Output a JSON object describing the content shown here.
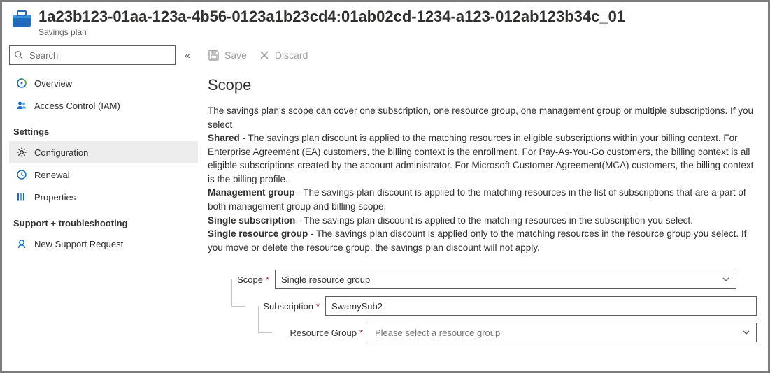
{
  "header": {
    "title": "1a23b123-01aa-123a-4b56-0123a1b23cd4:01ab02cd-1234-a123-012ab123b34c_01",
    "subtitle": "Savings plan"
  },
  "search": {
    "placeholder": "Search"
  },
  "nav": {
    "top": [
      {
        "key": "overview",
        "label": "Overview"
      },
      {
        "key": "iam",
        "label": "Access Control (IAM)"
      }
    ],
    "settingsHeader": "Settings",
    "settings": [
      {
        "key": "configuration",
        "label": "Configuration",
        "selected": true
      },
      {
        "key": "renewal",
        "label": "Renewal"
      },
      {
        "key": "properties",
        "label": "Properties"
      }
    ],
    "supportHeader": "Support + troubleshooting",
    "support": [
      {
        "key": "newsupport",
        "label": "New Support Request"
      }
    ]
  },
  "toolbar": {
    "save": "Save",
    "discard": "Discard"
  },
  "scope": {
    "heading": "Scope",
    "intro": "The savings plan's scope can cover one subscription, one resource group, one management group or multiple subscriptions. If you select",
    "sharedLabel": "Shared",
    "sharedText": " - The savings plan discount is applied to the matching resources in eligible subscriptions within your billing context. For Enterprise Agreement (EA) customers, the billing context is the enrollment. For Pay-As-You-Go customers, the billing context is all eligible subscriptions created by the account administrator. For Microsoft Customer Agreement(MCA) customers, the billing context is the billing profile.",
    "mgmtLabel": "Management group",
    "mgmtText": " - The savings plan discount is applied to the matching resources in the list of subscriptions that are a part of both management group and billing scope.",
    "subLabel": "Single subscription",
    "subText": " - The savings plan discount is applied to the matching resources in the subscription you select.",
    "rgLabel": "Single resource group",
    "rgText": " - The savings plan discount is applied only to the matching resources in the resource group you select. If you move or delete the resource group, the savings plan discount will not apply."
  },
  "form": {
    "scopeLabel": "Scope",
    "scopeValue": "Single resource group",
    "subscriptionLabel": "Subscription",
    "subscriptionValue": "SwamySub2",
    "rgLabel": "Resource Group",
    "rgPlaceholder": "Please select a resource group"
  }
}
